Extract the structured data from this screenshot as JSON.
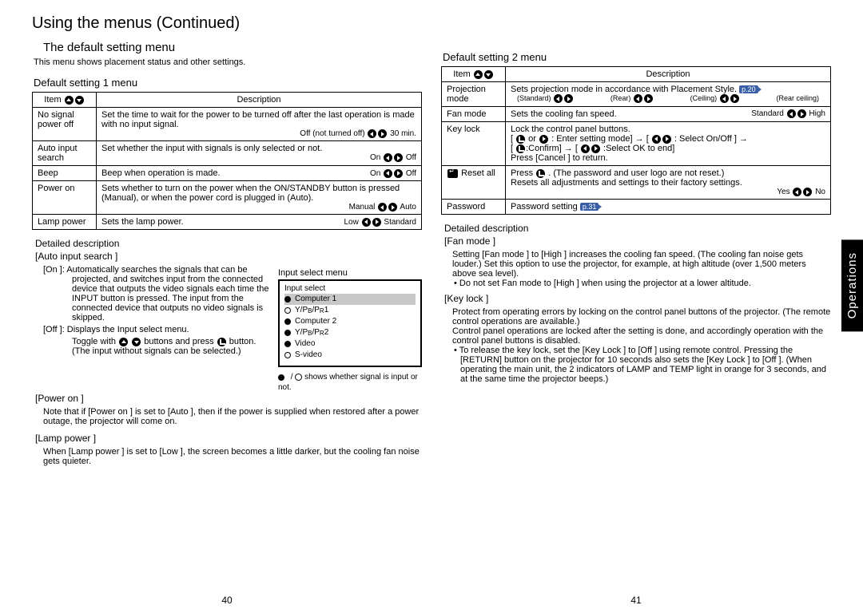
{
  "heading": "Using the menus (Continued)",
  "left": {
    "h2": "The default setting menu",
    "intro": "This menu shows placement status and other settings.",
    "h3": "Default setting 1 menu",
    "th_item": "Item",
    "th_desc": "Description",
    "r1a": "No signal power off",
    "r1b": "Set the time to wait for the power to be turned off after the last operation is made with no input signal.",
    "r1c": "Off (not turned off)",
    "r1d": "30 min.",
    "r2a": "Auto input search",
    "r2b": "Set whether the input with signals is only selected or not.",
    "r2c": "On",
    "r2d": "Off",
    "r3a": "Beep",
    "r3b": "Beep when operation is made.",
    "r3c": "On",
    "r3d": "Off",
    "r4a": "Power on",
    "r4b": "Sets whether to turn on the power when the ON/STANDBY button is pressed (Manual), or when the power cord is plugged in (Auto).",
    "r4c": "Manual",
    "r4d": "Auto",
    "r5a": "Lamp power",
    "r5b": "Sets the lamp power.",
    "r5c": "Low",
    "r5d": "Standard",
    "dd_title": "Detailed description",
    "dd_auto": "[Auto input search ]",
    "dd_on": "[On ]: Automatically searches the signals that can be projected, and switches input from the connected device that outputs the video signals each time the INPUT button is pressed. The input from the connected device that outputs no video signals is skipped.",
    "dd_off": "[Off ]: Displays the Input select   menu.",
    "dd_toggle": "Toggle with ",
    "dd_toggle2": " buttons and press ",
    "dd_toggle3": " button. (The input without signals can be selected.)",
    "menu_title": "Input select menu",
    "menu_header": "Input select",
    "mi1": "Computer 1",
    "mi2": "Y/P",
    "mi2b": "B",
    "mi2c": "/P",
    "mi2d": "R",
    "mi2e": " 1",
    "mi3": "Computer 2",
    "mi4e": " 2",
    "mi5": "Video",
    "mi6": "S-video",
    "menu_note": " shows whether signal is input or not.",
    "dd_power": "[Power on ]",
    "dd_power_text": "Note that if [Power on ] is set to [Auto ], then if the power is supplied when restored after a power outage, the projector will come on.",
    "dd_lamp": "[Lamp power ]",
    "dd_lamp_text": "When [Lamp power ] is set to [Low ], the screen becomes a little darker, but the cooling fan noise gets quieter.",
    "page": "40"
  },
  "right": {
    "h3": "Default setting 2 menu",
    "th_item": "Item",
    "th_desc": "Description",
    "r1a": "Projection mode",
    "r1b": "Sets projection mode in accordance with Placement Style.",
    "r1p": "p.20",
    "r1s1": "(Standard)",
    "r1s2": "(Rear)",
    "r1s3": "(Ceiling)",
    "r1s4": "(Rear ceiling)",
    "r2a": "Fan mode",
    "r2b": "Sets the cooling fan speed.",
    "r2c": "Standard",
    "r2d": "High",
    "r3a": "Key lock",
    "r3b": "Lock the control panel buttons.",
    "r3c": " : Enter setting mode] → [ ",
    "r3d": " : Select On/Off ] →",
    "r3e": ":Confirm] → [ ",
    "r3f": " :Select OK to end]",
    "r3g": "Press [Cancel ] to return.",
    "r4a": "Reset all",
    "r4b": "Press ",
    "r4c": " . (The password and user logo are not reset.)",
    "r4d": "Resets all adjustments and settings to their factory settings.",
    "r4e": "Yes",
    "r4f": "No",
    "r5a": "Password",
    "r5b": "Password setting",
    "r5p": "p.31",
    "dd_title": "Detailed description",
    "dd_fan": "[Fan mode ]",
    "dd_fan_t1": "Setting [Fan mode ] to [High ] increases the cooling fan speed. (The cooling fan noise gets louder.) Set this option to use the projector, for example, at high altitude (over 1,500 meters above sea level).",
    "dd_fan_b1": "• Do not set Fan mode to [High ] when using the projector at a lower altitude.",
    "dd_key": "[Key lock ]",
    "dd_key_t1": "Protect from operating errors by locking on the control panel buttons of the projector. (The remote control operations are available.)",
    "dd_key_t2": "Control panel operations are locked after the setting is done, and accordingly operation with the control panel buttons is disabled.",
    "dd_key_b1": "• To release the key lock, set the [Key Lock ] to [Off ] using remote control. Pressing the [RETURN] button on the projector for 10 seconds also sets the [Key Lock ] to [Off ]. (When operating the main unit, the 2 indicators of LAMP and TEMP light in orange for 3 seconds, and at the same time the projector beeps.)",
    "page": "41",
    "tab": "Operations"
  }
}
